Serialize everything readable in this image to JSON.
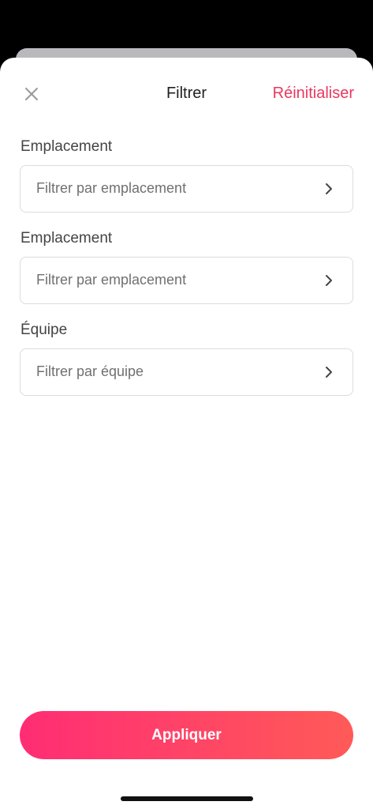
{
  "header": {
    "title": "Filtrer",
    "reset_label": "Réinitialiser"
  },
  "filters": [
    {
      "label": "Emplacement",
      "placeholder": "Filtrer par emplacement"
    },
    {
      "label": "Emplacement",
      "placeholder": "Filtrer par emplacement"
    },
    {
      "label": "Équipe",
      "placeholder": "Filtrer par équipe"
    }
  ],
  "apply_label": "Appliquer",
  "icons": {
    "close": "close-icon",
    "chevron": "chevron-right-icon"
  },
  "colors": {
    "accent": "#e8385f",
    "button_gradient_start": "#ff2d74",
    "button_gradient_end": "#ff5a58"
  }
}
